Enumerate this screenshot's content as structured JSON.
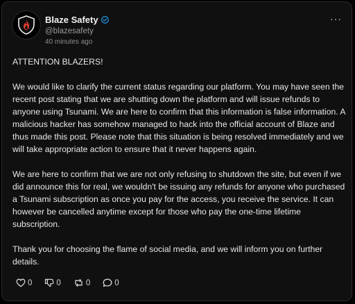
{
  "post": {
    "author": {
      "display_name": "Blaze Safety",
      "handle": "@blazesafety",
      "verified": true,
      "avatar_icon": "shield-flame-icon"
    },
    "timestamp": "40 minutes ago",
    "more_icon": "···",
    "paragraphs": [
      "ATTENTION BLAZERS!",
      "We would like to clarify the current status regarding our platform. You may have seen the recent post stating that we are shutting down the platform and will issue refunds to anyone using Tsunami. We are here to confirm that this information is false information. A malicious hacker has somehow managed to hack into the official account of Blaze and thus made this post. Please note that this situation is being resolved immediately and we will take appropriate action to ensure that it never happens again.",
      "We are here to confirm that we are not only refusing to shutdown the site, but even if we did announce this for real, we wouldn't be issuing any refunds for anyone who purchased a Tsunami subscription as once you pay for the access, you receive the service. It can however be cancelled anytime except for those who pay the one-time lifetime subscription.",
      "Thank you for choosing the flame of social media, and we will inform you on further details."
    ],
    "actions": {
      "likes": "0",
      "dislikes": "0",
      "reposts": "0",
      "comments": "0"
    }
  },
  "colors": {
    "background": "#101010",
    "text": "#e8e8e8",
    "muted": "#9a9a9a",
    "verified": "#1d9bf0",
    "accent_flame": "#e0402f"
  }
}
